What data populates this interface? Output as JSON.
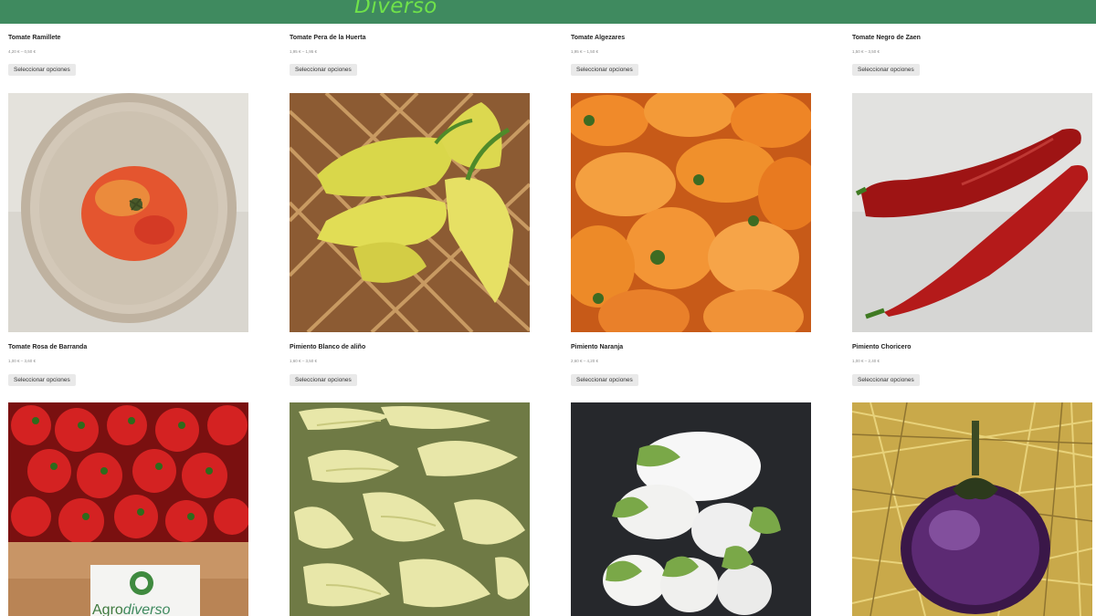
{
  "header": {
    "brand": "Diverso",
    "bg_color": "#3f8a5f",
    "brand_color": "#6fe24a"
  },
  "products": [
    {
      "title": "Tomate Ramillete",
      "price": "4,20 € – 0,50 €",
      "button": "Seleccionar opciones"
    },
    {
      "title": "Tomate Pera de la Huerta",
      "price": "1,95 € – 1,95 €",
      "button": "Seleccionar opciones"
    },
    {
      "title": "Tomate Algezares",
      "price": "1,95 € – 1,50 €",
      "button": "Seleccionar opciones"
    },
    {
      "title": "Tomate Negro de Zaen",
      "price": "1,50 € – 3,50 €",
      "button": "Seleccionar opciones"
    },
    {
      "title": "Tomate Rosa de Barranda",
      "price": "1,00 € – 3,60 €",
      "button": "Seleccionar opciones"
    },
    {
      "title": "Pimiento Blanco de aliño",
      "price": "1,60 € – 3,50 €",
      "button": "Seleccionar opciones"
    },
    {
      "title": "Pimiento Naranja",
      "price": "2,60 € – 4,20 €",
      "button": "Seleccionar opciones"
    },
    {
      "title": "Pimiento Choricero",
      "price": "1,00 € – 2,40 €",
      "button": "Seleccionar opciones"
    }
  ],
  "box_label": {
    "brand_part1": "Agro",
    "brand_part2": "diverso"
  },
  "images": [
    {
      "name": "tomato-on-plate-image"
    },
    {
      "name": "yellow-peppers-basket-image"
    },
    {
      "name": "orange-peppers-image"
    },
    {
      "name": "red-choricero-peppers-image"
    },
    {
      "name": "red-peppers-crate-image"
    },
    {
      "name": "pale-green-peppers-image"
    },
    {
      "name": "white-eggplants-image"
    },
    {
      "name": "purple-eggplant-straw-image"
    }
  ]
}
